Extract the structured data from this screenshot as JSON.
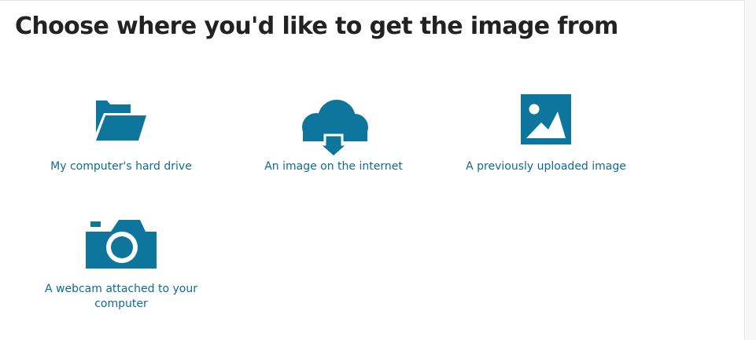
{
  "title": "Choose where you'd like to get the image from",
  "colors": {
    "icon": "#0e759c",
    "label": "#0e6b93",
    "title": "#222222"
  },
  "options": [
    {
      "label": "My computer's hard drive",
      "icon": "folder-open-icon"
    },
    {
      "label": "An image on the internet",
      "icon": "cloud-download-icon"
    },
    {
      "label": "A previously uploaded image",
      "icon": "image-icon"
    },
    {
      "label": "A webcam attached to your computer",
      "icon": "camera-icon"
    }
  ]
}
